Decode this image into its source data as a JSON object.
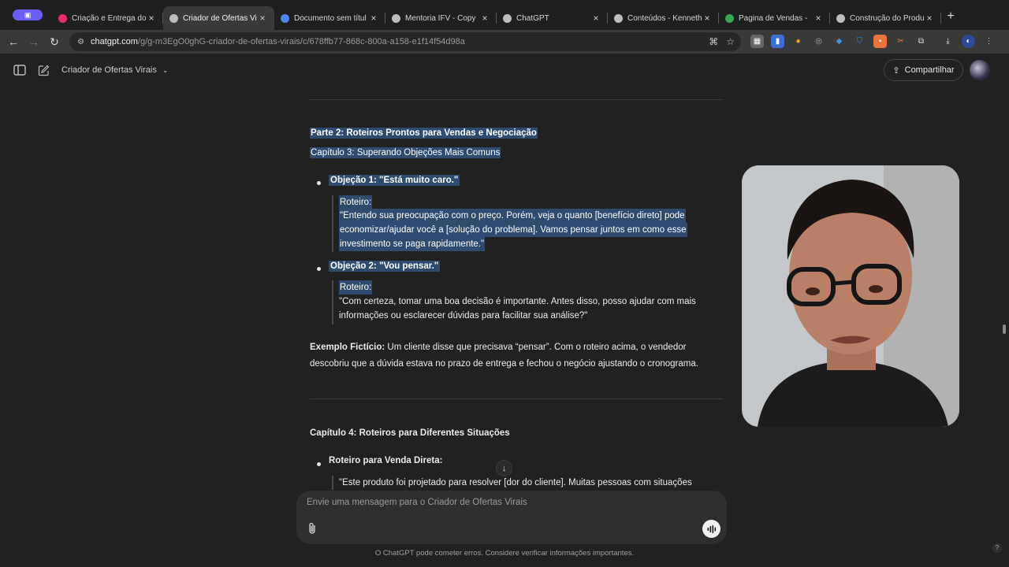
{
  "browser": {
    "tabs": [
      {
        "title": "Criação e Entrega do",
        "active": false,
        "favicon": "instagram-icon",
        "color": "#e1306c"
      },
      {
        "title": "Criador de Ofertas Vi",
        "active": true,
        "favicon": "chatgpt-icon",
        "color": "#bdbdbd"
      },
      {
        "title": "Documento sem títul",
        "active": false,
        "favicon": "docs-icon",
        "color": "#4a86f7"
      },
      {
        "title": "Mentoria IFV - Copy",
        "active": false,
        "favicon": "chatgpt-icon",
        "color": "#bdbdbd"
      },
      {
        "title": "ChatGPT",
        "active": false,
        "favicon": "chatgpt-icon",
        "color": "#bdbdbd"
      },
      {
        "title": "Conteúdos - Kenneth",
        "active": false,
        "favicon": "globe-icon",
        "color": "#bdbdbd"
      },
      {
        "title": "Pagina de Vendas - ",
        "active": false,
        "favicon": "drive-icon",
        "color": "#34a853"
      },
      {
        "title": "Construção do Produ",
        "active": false,
        "favicon": "globe-icon",
        "color": "#bdbdbd"
      }
    ],
    "url_host": "chatgpt.com",
    "url_path": "/g/g-m3EgO0ghG-criador-de-ofertas-virais/c/678ffb77-868c-800a-a158-e1f14f54d98a"
  },
  "app": {
    "gpt_name": "Criador de Ofertas Virais",
    "share_label": "Compartilhar"
  },
  "content": {
    "part_heading": "Parte 2: Roteiros Prontos para Vendas e Negociação",
    "chapter3_heading": "Capítulo 3: Superando Objeções Mais Comuns",
    "objection1_title": "Objeção 1: \"Está muito caro.\"",
    "objection1_label": "Roteiro:",
    "objection1_line1": "\"Entendo sua preocupação com o preço. Porém, veja o quanto [benefício direto] pode",
    "objection1_line2": "economizar/ajudar você a [solução do problema]. Vamos pensar juntos em como esse",
    "objection1_line3": "investimento se paga rapidamente.\"",
    "objection2_title": "Objeção 2: \"Vou pensar.\"",
    "objection2_label": "Roteiro:",
    "objection2_line1": "\"Com certeza, tomar uma boa decisão é importante. Antes disso, posso ajudar com mais",
    "objection2_line2": "informações ou esclarecer dúvidas para facilitar sua análise?\"",
    "example_label": "Exemplo Fictício:",
    "example_line1": " Um cliente disse que precisava “pensar”. Com o roteiro acima, o vendedor",
    "example_line2": "descobriu que a dúvida estava no prazo de entrega e fechou o negócio ajustando o cronograma.",
    "chapter4_heading": "Capítulo 4: Roteiros para Diferentes Situações",
    "direct_sale_title": "Roteiro para Venda Direta:",
    "direct_sale_line1": "\"Este produto foi projetado para resolver [dor do cliente]. Muitas pessoas com situações"
  },
  "composer": {
    "placeholder": "Envie uma mensagem para o Criador de Ofertas Virais"
  },
  "footer": {
    "disclaimer": "O ChatGPT pode cometer erros. Considere verificar informações importantes."
  },
  "help_label": "?"
}
